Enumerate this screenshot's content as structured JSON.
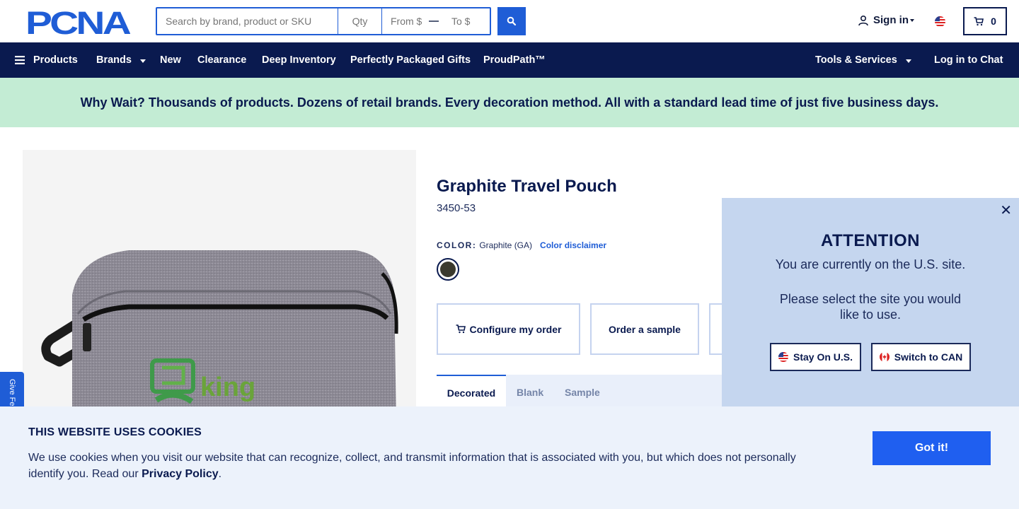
{
  "header": {
    "logo_text": "PCNA",
    "search_placeholder": "Search by brand, product or SKU",
    "qty_placeholder": "Qty",
    "price_from_placeholder": "From $",
    "price_to_placeholder": "To $",
    "sign_in_label": "Sign in",
    "cart_count": "0"
  },
  "nav": {
    "items": [
      {
        "label": "Products"
      },
      {
        "label": "Brands"
      },
      {
        "label": "New"
      },
      {
        "label": "Clearance"
      },
      {
        "label": "Deep Inventory"
      },
      {
        "label": "Perfectly Packaged Gifts"
      },
      {
        "label": "ProudPath™"
      }
    ],
    "tools_label": "Tools & Services",
    "chat_label": "Log in to Chat"
  },
  "promo": {
    "text": "Why Wait? Thousands of products. Dozens of retail brands. Every decoration method. All with a standard lead time of just five business days."
  },
  "product": {
    "title": "Graphite Travel Pouch",
    "sku": "3450-53",
    "color_label": "COLOR:",
    "color_value": "Graphite (GA)",
    "color_disclaimer": "Color disclaimer",
    "swatch_color": "#3b3a2e",
    "actions": {
      "configure_label": "Configure my order",
      "sample_label": "Order a sample"
    },
    "tabs": [
      {
        "label": "Decorated",
        "active": true
      },
      {
        "label": "Blank",
        "active": false
      },
      {
        "label": "Sample",
        "active": false
      }
    ],
    "image_logo_text": "king"
  },
  "feedback": {
    "label": "Give Fe"
  },
  "attention": {
    "title": "ATTENTION",
    "line1": "You are currently on the U.S. site.",
    "line2": "Please select the site you would",
    "line3": "like to use.",
    "stay_label": "Stay On U.S.",
    "switch_label": "Switch to CAN"
  },
  "cookie": {
    "title": "THIS WEBSITE USES COOKIES",
    "text_before": "We use cookies when you visit our website that can recognize, collect, and transmit information that is associated with you, but which does not personally identify you. Read our ",
    "link_label": "Privacy Policy",
    "text_after": ".",
    "button_label": "Got it!"
  },
  "colors": {
    "navy": "#0a1a4f",
    "accent_blue": "#1f5dd6",
    "promo_green": "#c3ecd4",
    "modal_bg": "#c5d6ef",
    "cookie_bg": "#ecf2fb"
  }
}
